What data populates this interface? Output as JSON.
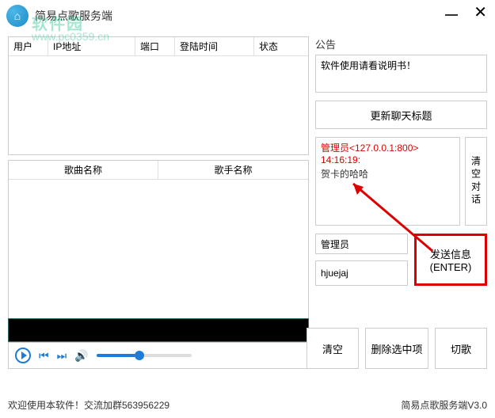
{
  "titlebar": {
    "title": "简易点歌服务端"
  },
  "watermark": {
    "text": "软件园",
    "url": "www.pc0359.cn"
  },
  "conn_table": {
    "headers": [
      "用户",
      "IP地址",
      "端口",
      "登陆时间",
      "状态"
    ]
  },
  "song_table": {
    "headers": [
      "歌曲名称",
      "歌手名称"
    ]
  },
  "announce": {
    "label": "公告",
    "text": "软件使用请看说明书！"
  },
  "update_title_btn": "更新聊天标题",
  "chat": {
    "admin_line": "管理员<127.0.0.1:800>",
    "time": "14:16:19:",
    "msg": "贺卡的哈哈"
  },
  "clear_chat_btn": "清空对话",
  "send": {
    "admin_value": "管理员",
    "input_value": "hjuejaj",
    "btn_line1": "发送信息",
    "btn_line2": "(ENTER)"
  },
  "actions": {
    "clear": "清空",
    "delete": "删除选中项",
    "cut": "切歌"
  },
  "status": {
    "left": "欢迎使用本软件！交流加群563956229",
    "right": "简易点歌服务端V3.0"
  }
}
